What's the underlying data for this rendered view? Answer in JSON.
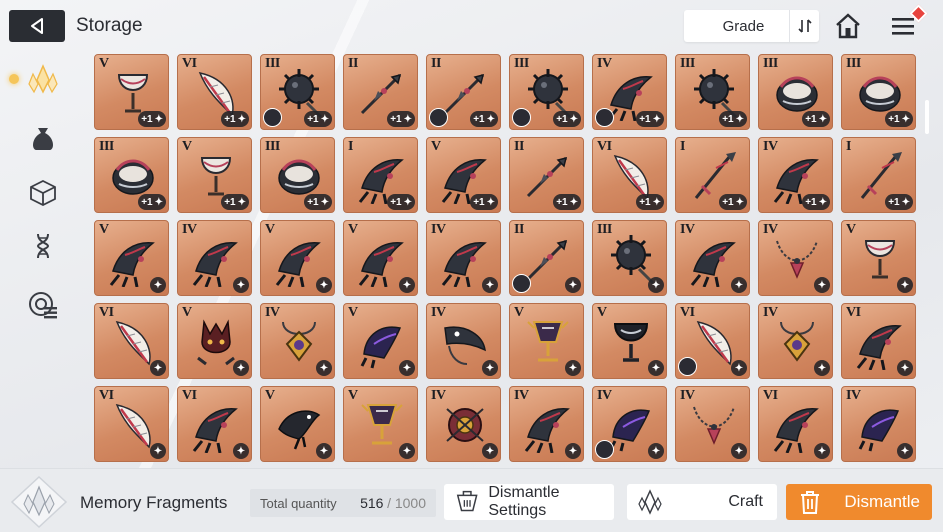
{
  "header": {
    "title": "Storage",
    "grade_filter": "Grade"
  },
  "sidebar": {
    "items": [
      {
        "name": "memory-fragment-icon",
        "active": true
      },
      {
        "name": "bag-icon",
        "active": false
      },
      {
        "name": "cube-icon",
        "active": false
      },
      {
        "name": "dna-icon",
        "active": false
      },
      {
        "name": "data-chip-icon",
        "active": false
      }
    ]
  },
  "grid": {
    "rows": [
      [
        {
          "grade": "V",
          "badge": "+1",
          "shape": "chalice"
        },
        {
          "grade": "VI",
          "badge": "+1",
          "shape": "feather"
        },
        {
          "grade": "III",
          "badge": "+1",
          "shape": "mace",
          "avatar": true
        },
        {
          "grade": "II",
          "badge": "+1",
          "shape": "spear"
        },
        {
          "grade": "II",
          "badge": "+1",
          "shape": "spear",
          "avatar": true
        },
        {
          "grade": "III",
          "badge": "+1",
          "shape": "mace",
          "avatar": true
        },
        {
          "grade": "IV",
          "badge": "+1",
          "shape": "claw",
          "avatar": true
        },
        {
          "grade": "III",
          "badge": "+1",
          "shape": "mace"
        },
        {
          "grade": "III",
          "badge": "+1",
          "shape": "pot"
        },
        {
          "grade": "III",
          "badge": "+1",
          "shape": "pot"
        }
      ],
      [
        {
          "grade": "III",
          "badge": "+1",
          "shape": "pot"
        },
        {
          "grade": "V",
          "badge": "+1",
          "shape": "chalice"
        },
        {
          "grade": "III",
          "badge": "+1",
          "shape": "pot"
        },
        {
          "grade": "I",
          "badge": "+1",
          "shape": "claw"
        },
        {
          "grade": "V",
          "badge": "+1",
          "shape": "claw"
        },
        {
          "grade": "II",
          "badge": "+1",
          "shape": "spear"
        },
        {
          "grade": "VI",
          "badge": "+1",
          "shape": "feather"
        },
        {
          "grade": "I",
          "badge": "+1",
          "shape": "sword"
        },
        {
          "grade": "IV",
          "badge": "+1",
          "shape": "claw"
        },
        {
          "grade": "I",
          "badge": "+1",
          "shape": "sword"
        }
      ],
      [
        {
          "grade": "V",
          "shape": "claw"
        },
        {
          "grade": "IV",
          "shape": "claw"
        },
        {
          "grade": "V",
          "shape": "claw"
        },
        {
          "grade": "V",
          "shape": "claw"
        },
        {
          "grade": "IV",
          "shape": "claw"
        },
        {
          "grade": "II",
          "shape": "spear",
          "avatar": true
        },
        {
          "grade": "III",
          "shape": "mace"
        },
        {
          "grade": "IV",
          "shape": "claw"
        },
        {
          "grade": "IV",
          "shape": "necklace"
        },
        {
          "grade": "V",
          "shape": "chalice"
        }
      ],
      [
        {
          "grade": "VI",
          "shape": "feather"
        },
        {
          "grade": "V",
          "shape": "demon"
        },
        {
          "grade": "IV",
          "shape": "amulet"
        },
        {
          "grade": "V",
          "shape": "gauntlet"
        },
        {
          "grade": "IV",
          "shape": "beak"
        },
        {
          "grade": "V",
          "shape": "goblet"
        },
        {
          "grade": "V",
          "shape": "cup"
        },
        {
          "grade": "VI",
          "shape": "feather",
          "avatar": true
        },
        {
          "grade": "IV",
          "shape": "amulet"
        },
        {
          "grade": "VI",
          "shape": "claw"
        }
      ],
      [
        {
          "grade": "VI",
          "shape": "feather"
        },
        {
          "grade": "VI",
          "shape": "claw"
        },
        {
          "grade": "V",
          "shape": "bird"
        },
        {
          "grade": "V",
          "shape": "goblet"
        },
        {
          "grade": "IV",
          "shape": "orb"
        },
        {
          "grade": "IV",
          "shape": "claw"
        },
        {
          "grade": "IV",
          "shape": "gauntlet",
          "avatar": true
        },
        {
          "grade": "IV",
          "shape": "necklace"
        },
        {
          "grade": "VI",
          "shape": "claw"
        },
        {
          "grade": "IV",
          "shape": "gauntlet"
        }
      ]
    ]
  },
  "footer": {
    "currency_label": "Memory Fragments",
    "quantity_label": "Total quantity",
    "quantity_current": "516",
    "quantity_max": "/ 1000",
    "settings_label": "Dismantle Settings",
    "craft_label": "Craft",
    "dismantle_label": "Dismantle"
  },
  "colors": {
    "card_bg": "#d38a63",
    "accent": "#f08a2d",
    "dark": "#2a2d33"
  }
}
